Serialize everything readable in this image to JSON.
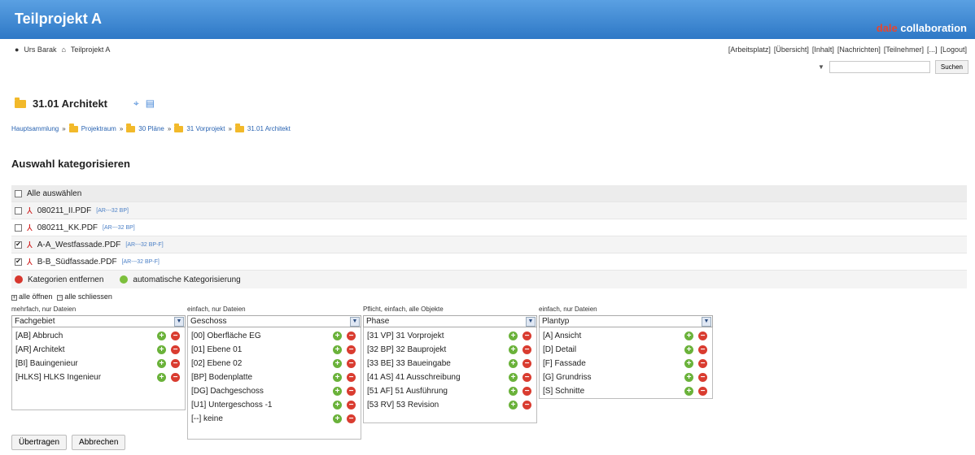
{
  "header": {
    "title": "Teilprojekt A",
    "brand_accent": "dale",
    "brand_rest": " collaboration",
    "colors": {
      "bar": "#3a86d4",
      "accent": "#e8452c"
    }
  },
  "user": {
    "name": "Urs Barak",
    "project": "Teilprojekt A"
  },
  "toplinks": [
    "[Arbeitsplatz]",
    "[Übersicht]",
    "[Inhalt]",
    "[Nachrichten]",
    "[Teilnehmer]",
    "[...]",
    "[Logout]"
  ],
  "search": {
    "value": "",
    "button": "Suchen"
  },
  "folder": {
    "title": "31.01 Architekt"
  },
  "breadcrumb": [
    "Hauptsammlung",
    "Projektraum",
    "30 Pläne",
    "31 Vorprojekt",
    "31.01 Architekt"
  ],
  "section_title": "Auswahl kategorisieren",
  "select_all": "Alle auswählen",
  "files": [
    {
      "name": "080211_II.PDF",
      "tag": "[AR---32 BP]",
      "checked": false
    },
    {
      "name": "080211_KK.PDF",
      "tag": "[AR---32 BP]",
      "checked": false
    },
    {
      "name": "A-A_Westfassade.PDF",
      "tag": "[AR---32 BP-F]",
      "checked": true
    },
    {
      "name": "B-B_Südfassade.PDF",
      "tag": "[AR---32 BP-F]",
      "checked": true
    }
  ],
  "actions": {
    "remove": "Kategorien entfernen",
    "auto": "automatische Kategorisierung"
  },
  "open_all": "alle öffnen",
  "close_all": "alle schliessen",
  "categories": [
    {
      "hint": "mehrfach, nur Dateien",
      "select": "Fachgebiet",
      "items": [
        "[AB] Abbruch",
        "[AR] Architekt",
        "[BI] Bauingenieur",
        "[HLKS] HLKS Ingenieur"
      ]
    },
    {
      "hint": "einfach, nur Dateien",
      "select": "Geschoss",
      "items": [
        "[00] Oberfläche EG",
        "[01] Ebene 01",
        "[02] Ebene 02",
        "[BP] Bodenplatte",
        "[DG] Dachgeschoss",
        "[U1] Untergeschoss -1",
        "[--] keine"
      ]
    },
    {
      "hint": "Pflicht, einfach, alle Objekte",
      "select": "Phase",
      "items": [
        "[31 VP] 31 Vorprojekt",
        "[32 BP] 32 Bauprojekt",
        "[33 BE] 33 Baueingabe",
        "[41 AS] 41 Ausschreibung",
        "[51 AF] 51 Ausführung",
        "[53 RV] 53 Revision"
      ]
    },
    {
      "hint": "einfach, nur Dateien",
      "select": "Plantyp",
      "items": [
        "[A] Ansicht",
        "[D] Detail",
        "[F] Fassade",
        "[G] Grundriss",
        "[S] Schnitte"
      ]
    }
  ],
  "buttons": {
    "submit": "Übertragen",
    "cancel": "Abbrechen"
  }
}
